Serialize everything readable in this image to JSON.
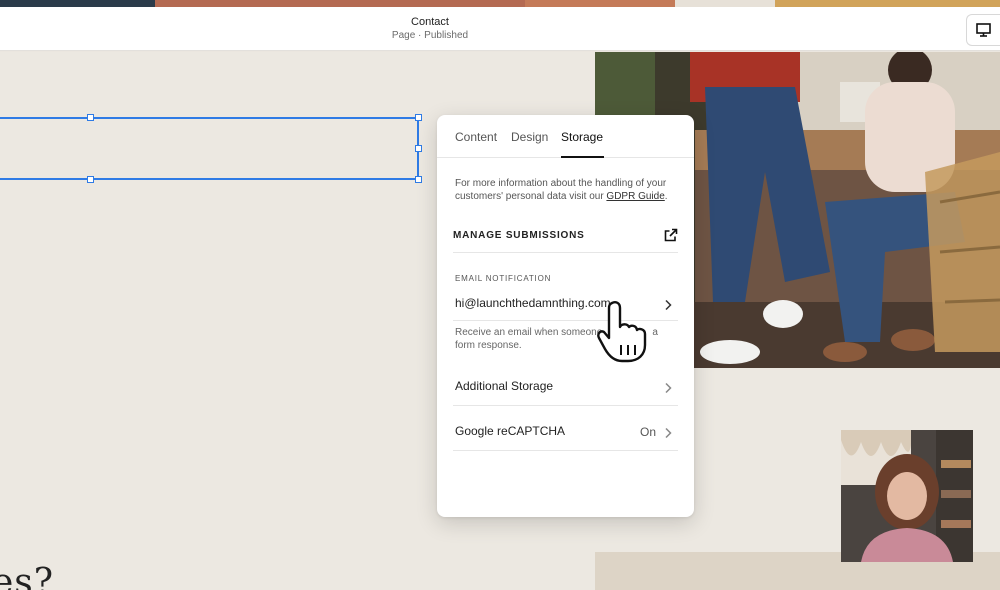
{
  "header": {
    "page_name": "Contact",
    "page_status": "Page · Published",
    "device_icon": "desktop-icon"
  },
  "colors": {
    "accent_selection": "#2f7be5",
    "strip": [
      "#2b3b4a",
      "#b46a52",
      "#c47a58",
      "#e7e1d8",
      "#d1a35a"
    ]
  },
  "panel": {
    "tabs": [
      {
        "label": "Content"
      },
      {
        "label": "Design"
      },
      {
        "label": "Storage",
        "active": true
      }
    ],
    "info_text": "For more information about the handling of your customers' personal data visit our ",
    "info_link": "GDPR Guide",
    "info_end": ".",
    "manage_submissions": "MANAGE SUBMISSIONS",
    "manage_icon": "external-link-icon",
    "email_notification": {
      "heading": "EMAIL NOTIFICATION",
      "value": "hi@launchthedamnthing.com",
      "description_line1": "Receive an email when someone",
      "description_tail": "a",
      "description_line2": "form response."
    },
    "additional_storage": "Additional Storage",
    "recaptcha": {
      "label": "Google reCAPTCHA",
      "status": "On"
    }
  },
  "canvas": {
    "script_text": "es?"
  }
}
